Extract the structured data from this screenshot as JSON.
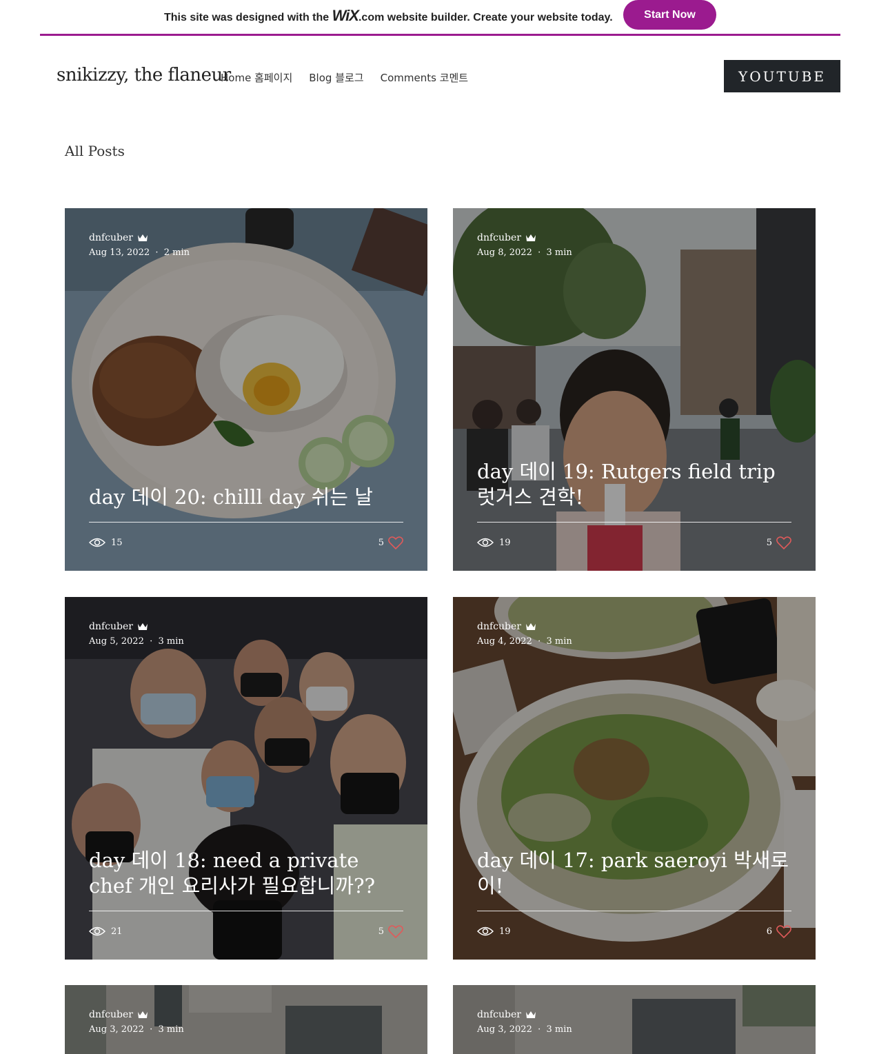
{
  "banner": {
    "text_before": "This site was designed with the ",
    "logo": "WiX",
    "text_after": ".com website builder. Create your website today.",
    "button": "Start Now",
    "accent": "#9b1b8f"
  },
  "header": {
    "site_title": "snikizzy, the flaneur",
    "nav": [
      "Home 홈페이지",
      "Blog 블로그",
      "Comments 코멘트"
    ],
    "youtube": "YOUTUBE"
  },
  "section_title": "All Posts",
  "posts": [
    {
      "author": "dnfcuber",
      "date": "Aug 13, 2022",
      "read": "2 min",
      "title": "day 데이 20: chilll day 쉬는 날",
      "views": "15",
      "likes": "5"
    },
    {
      "author": "dnfcuber",
      "date": "Aug 8, 2022",
      "read": "3 min",
      "title": "day 데이 19: Rutgers field trip 럿거스 견학!",
      "views": "19",
      "likes": "5"
    },
    {
      "author": "dnfcuber",
      "date": "Aug 5, 2022",
      "read": "3 min",
      "title": "day 데이 18: need a private chef 개인 요리사가 필요합니까??",
      "views": "21",
      "likes": "5"
    },
    {
      "author": "dnfcuber",
      "date": "Aug 4, 2022",
      "read": "3 min",
      "title": "day 데이 17: park saeroyi 박새로이!",
      "views": "19",
      "likes": "6"
    },
    {
      "author": "dnfcuber",
      "date": "Aug 3, 2022",
      "read": "3 min"
    },
    {
      "author": "dnfcuber",
      "date": "Aug 3, 2022",
      "read": "3 min"
    }
  ],
  "icons": {
    "crown": "crown-icon",
    "views": "eye-icon",
    "likes": "heart-icon"
  },
  "colors": {
    "heart": "#e05a5a"
  }
}
